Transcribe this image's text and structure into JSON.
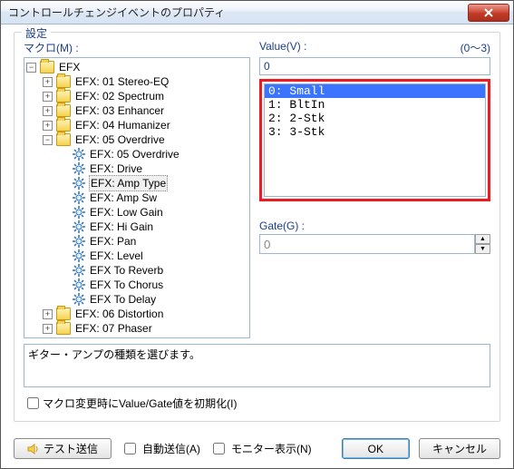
{
  "title": "コントロールチェンジイベントのプロパティ",
  "fieldset_legend": "設定",
  "macro": {
    "label": "マクロ(M) :"
  },
  "tree": {
    "root": "EFX",
    "items": [
      "EFX: 01 Stereo-EQ",
      "EFX: 02 Spectrum",
      "EFX: 03 Enhancer",
      "EFX: 04 Humanizer"
    ],
    "overdrive": {
      "label": "EFX: 05 Overdrive",
      "children": [
        "EFX: 05 Overdrive",
        "EFX: Drive",
        "EFX: Amp Type",
        "EFX: Amp Sw",
        "EFX: Low Gain",
        "EFX: Hi Gain",
        "EFX: Pan",
        "EFX: Level",
        "EFX To Reverb",
        "EFX To Chorus",
        "EFX To Delay"
      ],
      "selected_index": 2
    },
    "tail": [
      "EFX: 06 Distortion",
      "EFX: 07 Phaser"
    ]
  },
  "value": {
    "label": "Value(V) :",
    "range": "(0～3)",
    "input": "0",
    "options": [
      "0: Small",
      "1: BltIn",
      "2: 2-Stk",
      "3: 3-Stk"
    ],
    "selected_index": 0
  },
  "gate": {
    "label": "Gate(G) :",
    "value": "0"
  },
  "description": "ギター・アンプの種類を選びます。",
  "reset_checkbox": "マクロ変更時にValue/Gate値を初期化(I)",
  "buttons": {
    "test_send": "テスト送信",
    "auto_send": "自動送信(A)",
    "monitor": "モニター表示(N)",
    "ok": "OK",
    "cancel": "キャンセル"
  }
}
